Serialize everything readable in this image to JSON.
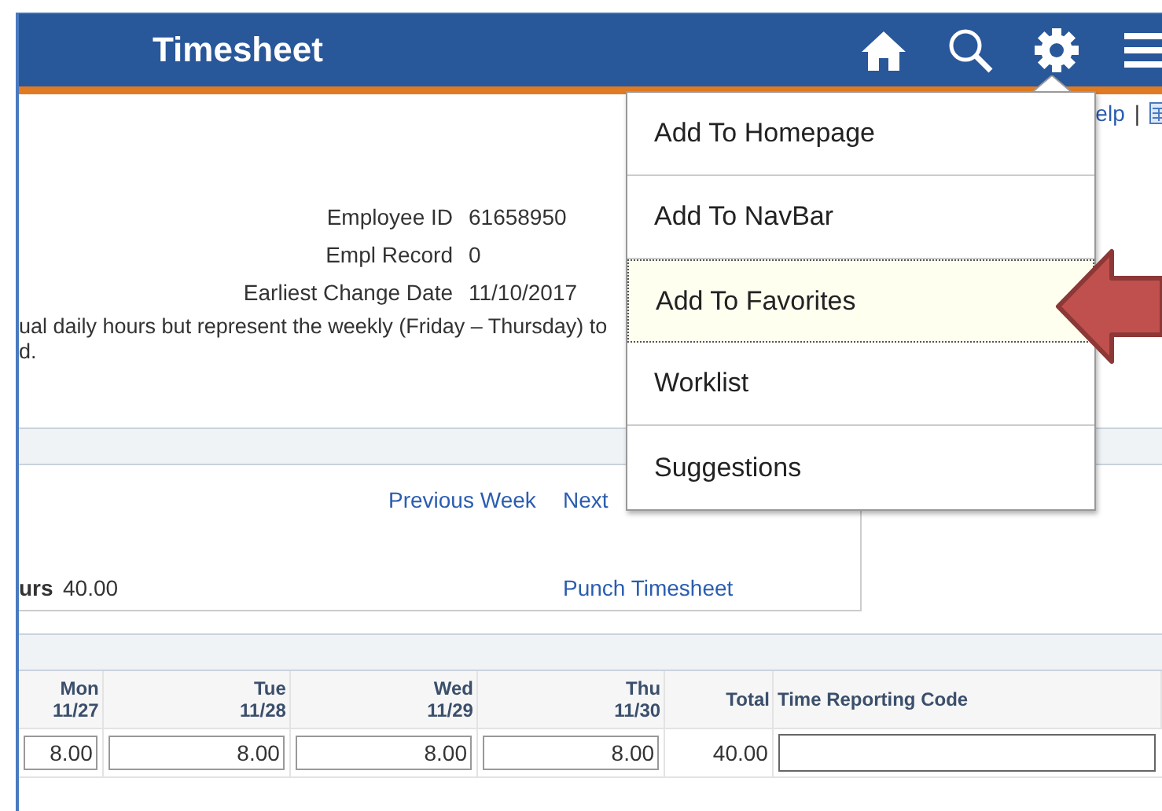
{
  "header": {
    "title": "Timesheet"
  },
  "toolbar_links": [
    "elp",
    "|"
  ],
  "employee_info": [
    {
      "label": "Employee ID",
      "value": "61658950"
    },
    {
      "label": "Empl Record",
      "value": "0"
    },
    {
      "label": "Earliest Change Date",
      "value": "11/10/2017"
    }
  ],
  "instructions": [
    "ual daily hours but represent the weekly (Friday – Thursday) to",
    "d."
  ],
  "period": {
    "previous_link": "Previous Week",
    "next_link": "Next",
    "hours_label": "urs",
    "hours_value": "40.00",
    "punch_link": "Punch Timesheet"
  },
  "table": {
    "columns": [
      {
        "day": "Mon",
        "date": "11/27"
      },
      {
        "day": "Tue",
        "date": "11/28"
      },
      {
        "day": "Wed",
        "date": "11/29"
      },
      {
        "day": "Thu",
        "date": "11/30"
      },
      {
        "day": "Total"
      },
      {
        "day": "Time Reporting Code"
      }
    ],
    "row": {
      "hours": [
        "8.00",
        "8.00",
        "8.00",
        "8.00"
      ],
      "total": "40.00"
    }
  },
  "menu": {
    "items": [
      {
        "label": "Add To Homepage",
        "selected": false
      },
      {
        "label": "Add To NavBar",
        "selected": false
      },
      {
        "label": "Add To Favorites",
        "selected": true
      },
      {
        "label": "Worklist",
        "selected": false
      },
      {
        "label": "Suggestions",
        "selected": false
      }
    ]
  }
}
